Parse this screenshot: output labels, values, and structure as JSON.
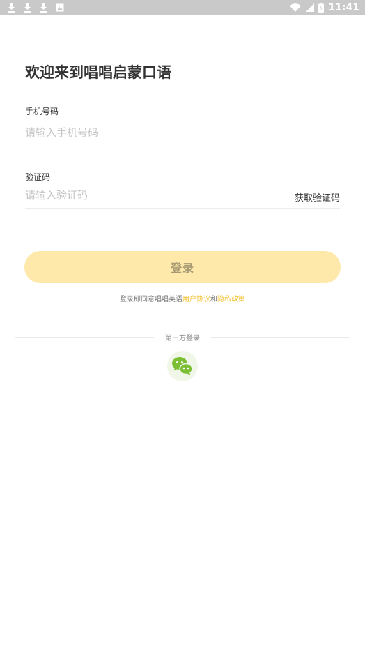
{
  "status_bar": {
    "time": "11:41",
    "left_icons": [
      "download-icon",
      "download-icon",
      "download-icon",
      "photo-icon"
    ],
    "right_icons": [
      "wifi-icon",
      "signal-icon",
      "battery-icon"
    ]
  },
  "login": {
    "title": "欢迎来到唱唱启蒙口语",
    "phone": {
      "label": "手机号码",
      "placeholder": "请输入手机号码",
      "value": ""
    },
    "code": {
      "label": "验证码",
      "placeholder": "请输入验证码",
      "value": "",
      "get_code_label": "获取验证码"
    },
    "submit_label": "登录",
    "agreement": {
      "prefix": "登录即同意唱唱英语",
      "user_agreement": "用户协议",
      "and": "和",
      "privacy_policy": "隐私政策"
    },
    "third_party": {
      "label": "第三方登录",
      "providers": [
        {
          "icon": "wechat-icon"
        }
      ]
    }
  },
  "colors": {
    "accent": "#f4c231",
    "button_bg": "#fee9ab",
    "button_text": "#a89a72",
    "wechat_green": "#7cbf35"
  }
}
